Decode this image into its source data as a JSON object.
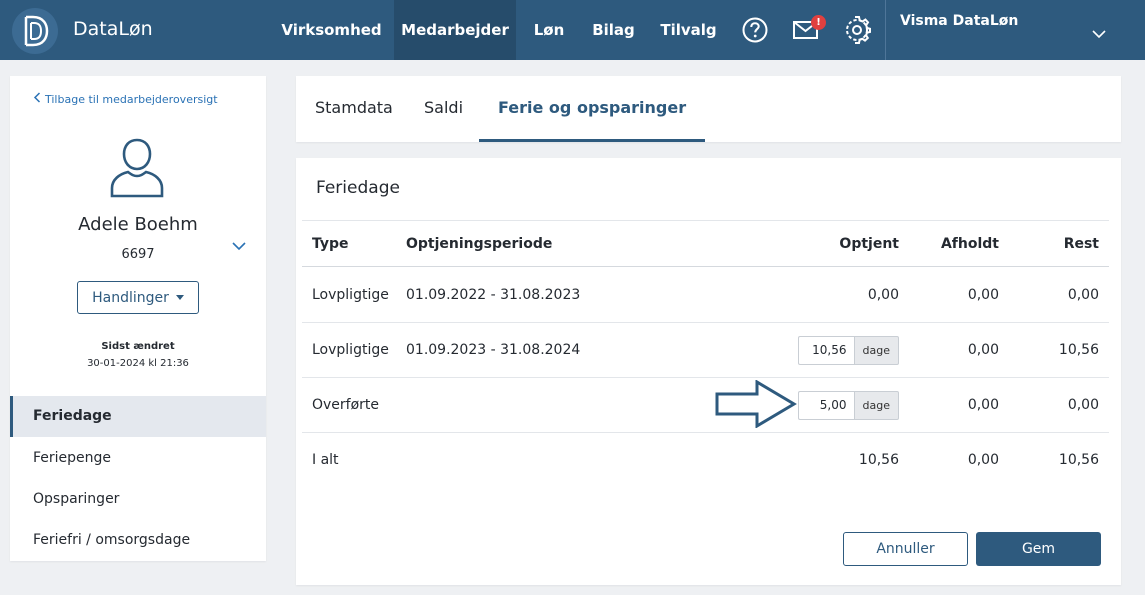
{
  "header": {
    "app_title": "DataLøn",
    "logo_icon": "dataloen-logo-icon",
    "nav": [
      {
        "label": "Virksomhed"
      },
      {
        "label": "Medarbejder"
      },
      {
        "label": "Løn"
      },
      {
        "label": "Bilag"
      },
      {
        "label": "Tilvalg"
      }
    ],
    "active_nav": "Medarbejder",
    "icons": [
      "help-icon",
      "mail-icon",
      "settings-icon"
    ],
    "mail_badge": "!",
    "company": "Visma DataLøn"
  },
  "sidebar": {
    "back_label": "Tilbage til medarbejderoversigt",
    "employee_name": "Adele Boehm",
    "employee_number": "6697",
    "actions_label": "Handlinger",
    "changed_label": "Sidst ændret",
    "changed_value": "30-01-2024 kl 21:36",
    "items": [
      {
        "label": "Feriedage",
        "active": true
      },
      {
        "label": "Feriepenge",
        "active": false
      },
      {
        "label": "Opsparinger",
        "active": false
      },
      {
        "label": "Feriefri / omsorgsdage",
        "active": false
      }
    ]
  },
  "tabs": [
    {
      "label": "Stamdata"
    },
    {
      "label": "Saldi"
    },
    {
      "label": "Ferie og opsparinger"
    }
  ],
  "active_tab": "Ferie og opsparinger",
  "section": {
    "title": "Feriedage",
    "columns": {
      "type": "Type",
      "period": "Optjeningsperiode",
      "earned": "Optjent",
      "held": "Afholdt",
      "rest": "Rest"
    },
    "rows": [
      {
        "type": "Lovpligtige",
        "period": "01.09.2022 - 31.08.2023",
        "earned": "0,00",
        "held": "0,00",
        "rest": "0,00"
      },
      {
        "type": "Lovpligtige",
        "period": "01.09.2023 - 31.08.2024",
        "earned": "10,56",
        "unit": "dage",
        "held": "0,00",
        "rest": "10,56"
      },
      {
        "type": "Overførte",
        "period": "",
        "earned": "5,00",
        "unit": "dage",
        "held": "0,00",
        "rest": "0,00"
      },
      {
        "type": "I alt",
        "period": "",
        "earned": "10,56",
        "held": "0,00",
        "rest": "10,56"
      }
    ]
  },
  "buttons": {
    "cancel": "Annuller",
    "save": "Gem"
  },
  "colors": {
    "primary": "#2e5a7e",
    "link": "#2a72b5",
    "badge": "#e0403f"
  }
}
